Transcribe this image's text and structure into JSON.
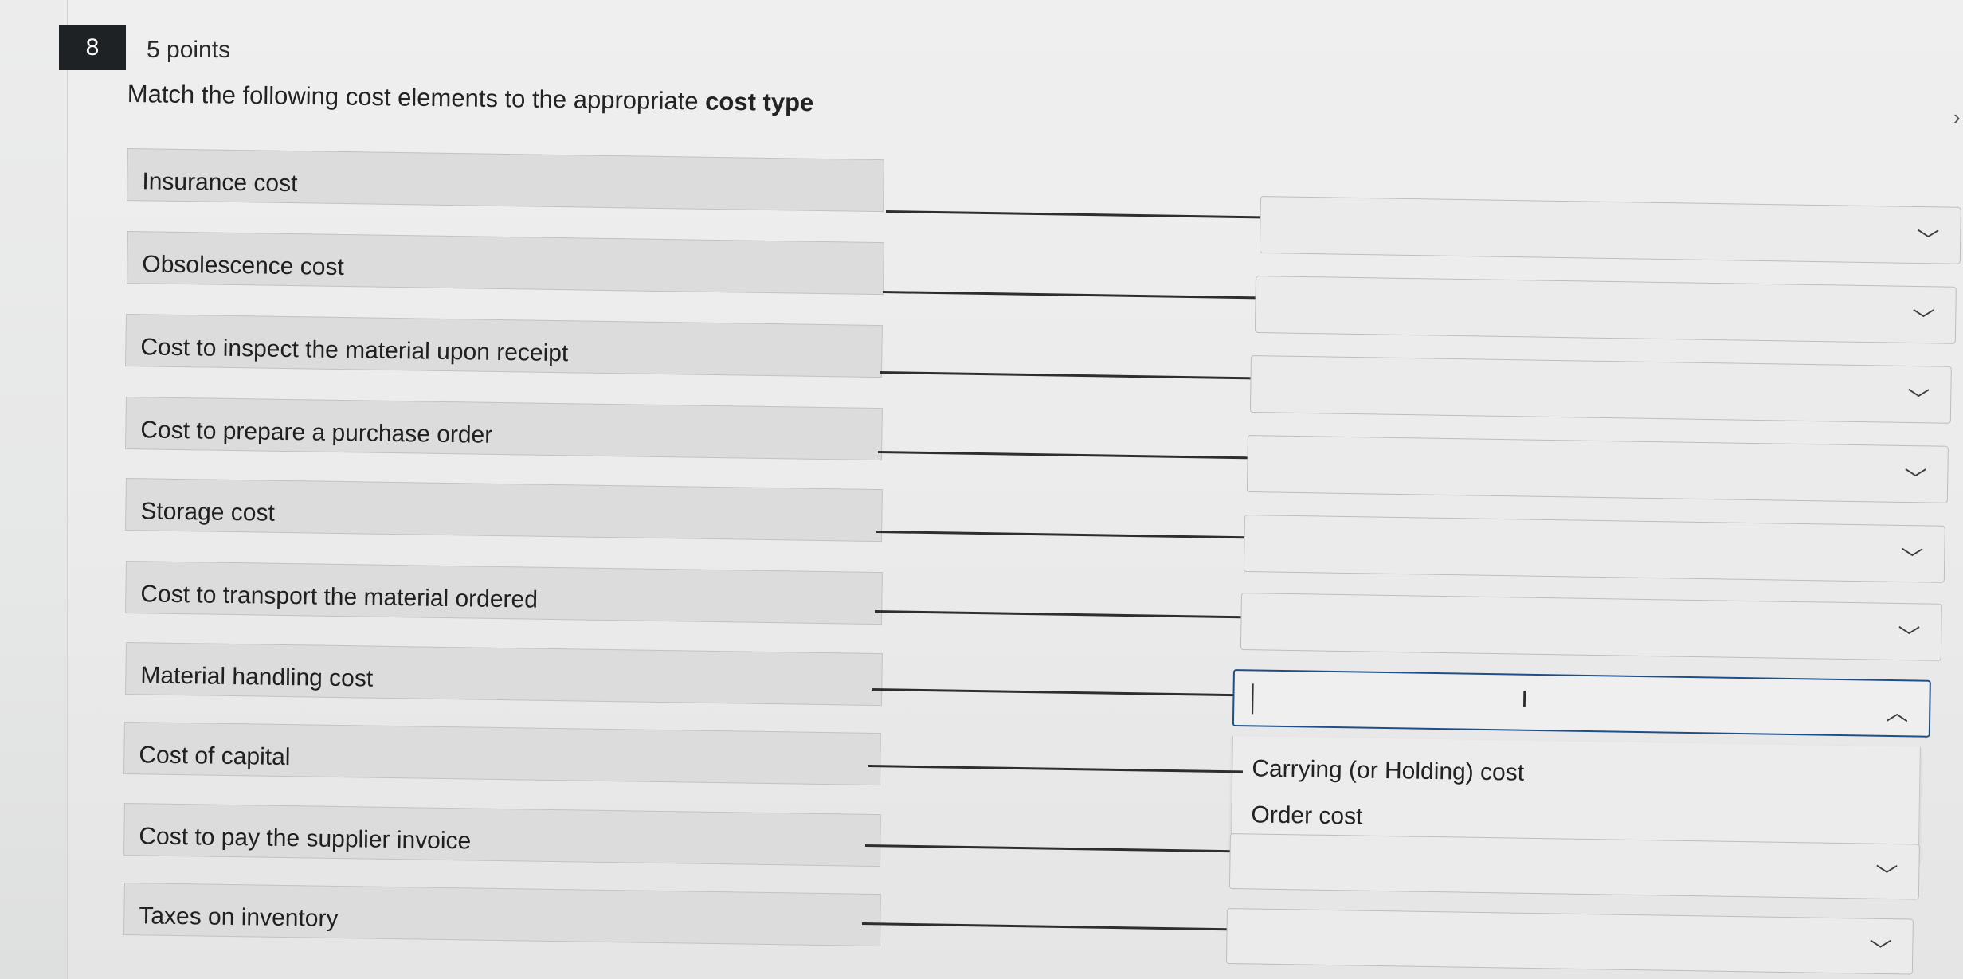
{
  "question": {
    "number": "8",
    "points": "5 points",
    "prompt_prefix": "Match the following cost elements to the appropriate",
    "prompt_bold": "cost type"
  },
  "rows": [
    {
      "term": "Insurance cost",
      "selected": ""
    },
    {
      "term": "Obsolescence cost",
      "selected": ""
    },
    {
      "term": "Cost to inspect the material upon receipt",
      "selected": ""
    },
    {
      "term": "Cost to prepare a purchase order",
      "selected": ""
    },
    {
      "term": "Storage cost",
      "selected": ""
    },
    {
      "term": "Cost to transport the material ordered",
      "selected": ""
    },
    {
      "term": "Material handling cost",
      "selected": ""
    },
    {
      "term": "Cost of capital",
      "selected": ""
    },
    {
      "term": "Cost to pay the supplier invoice",
      "selected": ""
    },
    {
      "term": "Taxes on inventory",
      "selected": ""
    }
  ],
  "open_dropdown": {
    "row_index": 6,
    "options": [
      "Carrying (or Holding) cost",
      "Order cost"
    ]
  },
  "icons": {
    "chevron_down": "chevron-down-icon",
    "chevron_up": "chevron-up-icon",
    "text_cursor": "i-beam-cursor-icon"
  }
}
